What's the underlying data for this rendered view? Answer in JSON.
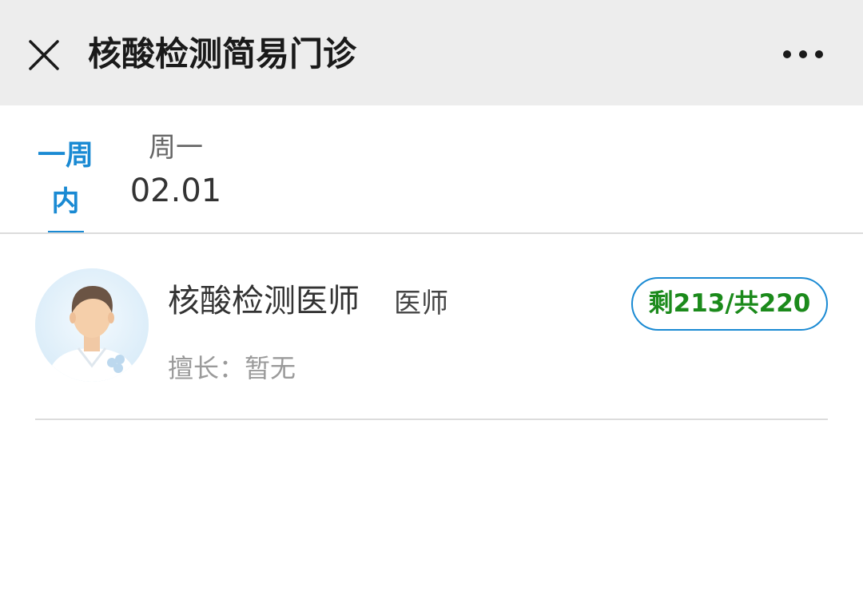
{
  "header": {
    "title": "核酸检测简易门诊",
    "close_icon": "close-icon",
    "more_icon": "more-icon"
  },
  "tabs": {
    "week": {
      "label": "一周内",
      "active": true
    },
    "days": [
      {
        "weekday": "周一",
        "date": "02.01"
      }
    ]
  },
  "doctor": {
    "name": "核酸检测医师",
    "title": "医师",
    "specialty": "擅长：暂无",
    "quota": "剩213/共220",
    "avatar_icon": "doctor-avatar"
  },
  "colors": {
    "accent": "#1a8ad3",
    "quota_text": "#1b8a1b",
    "header_bg": "#ededed"
  }
}
